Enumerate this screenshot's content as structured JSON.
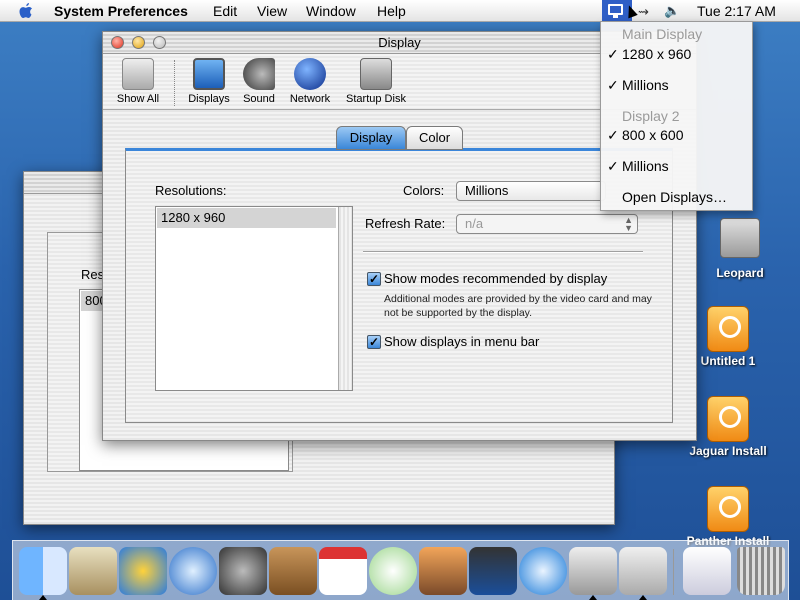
{
  "menubar": {
    "app_name": "System Preferences",
    "menus": [
      "Edit",
      "View",
      "Window",
      "Help"
    ],
    "clock": "Tue 2:17 AM"
  },
  "display_menu": {
    "main_header": "Main Display",
    "main_resolution": "1280 x 960",
    "main_colors": "Millions",
    "second_header": "Display 2",
    "second_resolution": "800 x 600",
    "second_colors": "Millions",
    "open_displays": "Open Displays…"
  },
  "desktop_icons": [
    {
      "label": "Leopard"
    },
    {
      "label": "Untitled 1"
    },
    {
      "label": "Jaguar Install"
    },
    {
      "label": "Panther Install"
    }
  ],
  "window": {
    "title": "Display",
    "toolbar": [
      "Show All",
      "Displays",
      "Sound",
      "Network",
      "Startup Disk"
    ],
    "tabs": [
      "Display",
      "Color"
    ],
    "resolutions_label": "Resolutions:",
    "resolutions": [
      "1280 x 960"
    ],
    "colors_label": "Colors:",
    "colors_value": "Millions",
    "refresh_label": "Refresh Rate:",
    "refresh_value": "n/a",
    "cb_recommended": "Show modes recommended by display",
    "cb_note": "Additional modes are provided by the video card and may not be supported by the display.",
    "cb_menubar": "Show displays in menu bar"
  },
  "back_window": {
    "label_partial": "Res",
    "item_partial": "800"
  }
}
